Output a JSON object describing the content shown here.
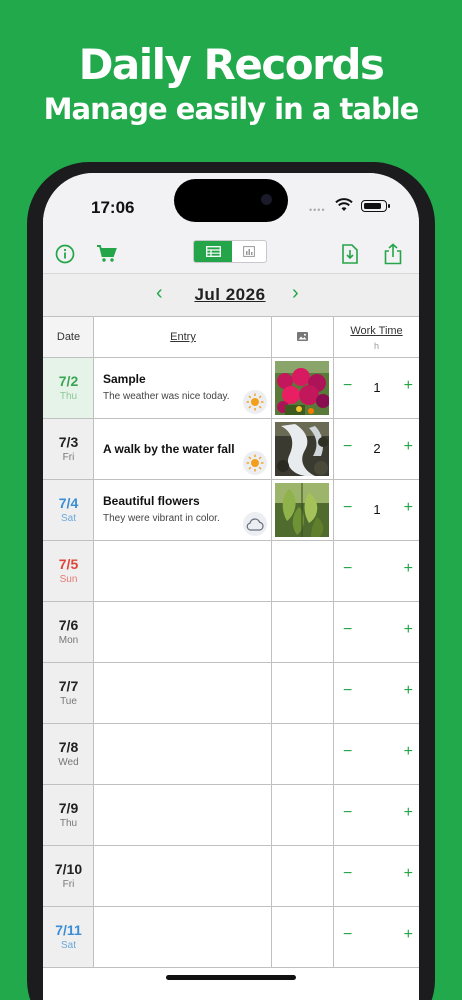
{
  "promo": {
    "title": "Daily Records",
    "subtitle": "Manage easily in a table"
  },
  "status": {
    "time": "17:06"
  },
  "toolbar": {
    "info_icon": "info-circle-icon",
    "cart_icon": "cart-icon",
    "table_view_icon": "table-icon",
    "chart_view_icon": "bar-chart-icon",
    "download_icon": "download-file-icon",
    "share_icon": "share-icon"
  },
  "month": {
    "label": "Jul 2026",
    "prev": "‹",
    "next": "›"
  },
  "headers": {
    "date": "Date",
    "entry": "Entry",
    "photo_icon": "image-icon",
    "work": "Work Time",
    "work_unit": "h"
  },
  "controls": {
    "minus": "−",
    "plus": "+"
  },
  "rows": [
    {
      "date": "7/2",
      "day": "Thu",
      "title": "Sample",
      "text": "The weather was nice today.",
      "weather": "sun-icon",
      "photo": "pink-flowers",
      "value": "1"
    },
    {
      "date": "7/3",
      "day": "Fri",
      "title": "A walk by the water fall",
      "text": "",
      "weather": "sun-icon",
      "photo": "waterfall",
      "value": "2"
    },
    {
      "date": "7/4",
      "day": "Sat",
      "title": "Beautiful flowers",
      "text": "They were vibrant in color.",
      "weather": "cloud-icon",
      "photo": "green-leaves",
      "value": "1"
    },
    {
      "date": "7/5",
      "day": "Sun",
      "title": "",
      "text": "",
      "value": ""
    },
    {
      "date": "7/6",
      "day": "Mon",
      "title": "",
      "text": "",
      "value": ""
    },
    {
      "date": "7/7",
      "day": "Tue",
      "title": "",
      "text": "",
      "value": ""
    },
    {
      "date": "7/8",
      "day": "Wed",
      "title": "",
      "text": "",
      "value": ""
    },
    {
      "date": "7/9",
      "day": "Thu",
      "title": "",
      "text": "",
      "value": ""
    },
    {
      "date": "7/10",
      "day": "Fri",
      "title": "",
      "text": "",
      "value": ""
    },
    {
      "date": "7/11",
      "day": "Sat",
      "title": "",
      "text": "",
      "value": ""
    }
  ],
  "colors": {
    "brand_green": "#22a94b",
    "saturday": "#3a8ed6",
    "sunday": "#e0453a"
  }
}
